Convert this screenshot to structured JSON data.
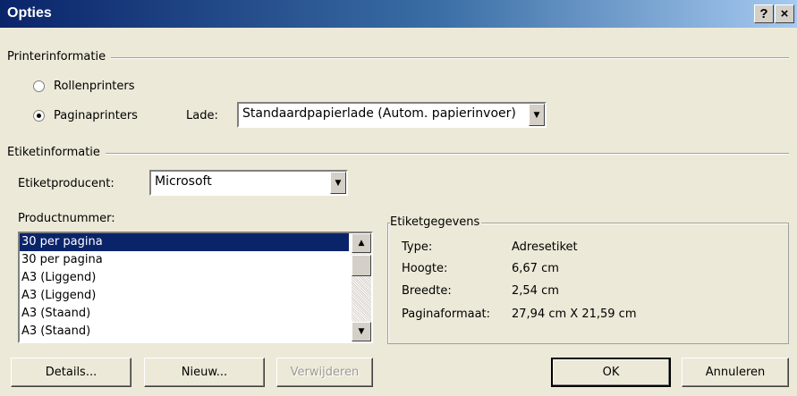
{
  "window": {
    "title": "Opties",
    "help_label": "?",
    "close_label": "×"
  },
  "printer_info": {
    "group_label": "Printerinformatie",
    "radio_continuous": "Rollenprinters",
    "radio_page": "Paginaprinters",
    "selected": "Paginaprinters",
    "tray_label": "Lade:",
    "tray_value": "Standaardpapierlade (Autom. papierinvoer)"
  },
  "label_info": {
    "group_label": "Etiketinformatie",
    "vendor_label": "Etiketproducent:",
    "vendor_value": "Microsoft"
  },
  "product": {
    "label": "Productnummer:",
    "items": [
      "30 per pagina",
      "30 per pagina",
      "A3 (Liggend)",
      "A3 (Liggend)",
      "A3 (Staand)",
      "A3 (Staand)"
    ],
    "selected_index": 0
  },
  "label_details": {
    "legend": "Etiketgegevens",
    "rows": [
      {
        "label": "Type:",
        "value": "Adresetiket"
      },
      {
        "label": "Hoogte:",
        "value": "6,67 cm"
      },
      {
        "label": "Breedte:",
        "value": "2,54 cm"
      },
      {
        "label": "Paginaformaat:",
        "value": "27,94 cm X 21,59 cm"
      }
    ]
  },
  "buttons": {
    "details": "Details...",
    "new": "Nieuw...",
    "delete": "Verwijderen",
    "ok": "OK",
    "cancel": "Annuleren"
  },
  "icons": {
    "dropdown": "chevron-down-icon",
    "scroll_up": "scroll-up-icon",
    "scroll_down": "scroll-down-icon"
  }
}
